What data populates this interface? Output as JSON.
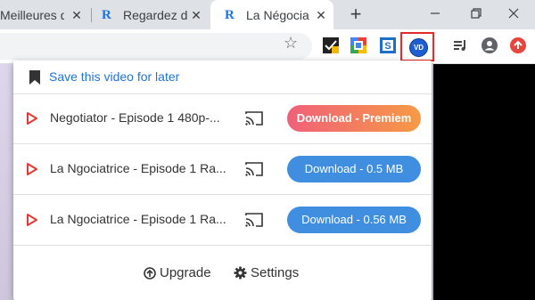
{
  "browser": {
    "tabs": [
      {
        "label": "Meilleures d",
        "close": "✕"
      },
      {
        "label": "Regardez d",
        "favicon": "R",
        "close": "✕"
      },
      {
        "label": "La Négocia",
        "favicon": "R",
        "close": "✕",
        "active": true
      }
    ],
    "new_tab": "+",
    "window_controls": [
      "minimize",
      "restore",
      "close"
    ]
  },
  "toolbar": {
    "bookmark_star": "☆",
    "extensions": [
      "checkmark-extension-icon",
      "google-translate-icon",
      "s-extension-icon",
      "video-downloader-icon"
    ],
    "vd_label": "VD"
  },
  "popup": {
    "save_link": "Save this video for later",
    "videos": [
      {
        "title": "Negotiator - Episode 1 480p-...",
        "download": "Download - Premiem",
        "style": "premium"
      },
      {
        "title": "La Ngociatrice - Episode 1 Ra...",
        "download": "Download - 0.5 MB",
        "style": "standard"
      },
      {
        "title": "La Ngociatrice - Episode 1 Ra...",
        "download": "Download - 0.56 MB",
        "style": "standard"
      }
    ],
    "upgrade_label": "Upgrade",
    "settings_label": "Settings"
  },
  "colors": {
    "link": "#1f73d8",
    "play_icon": "#e53935",
    "download_blue": "#3f8ee0",
    "premium_start": "#f0607a",
    "premium_end": "#f69a45",
    "highlight_box": "#e32b2b"
  }
}
